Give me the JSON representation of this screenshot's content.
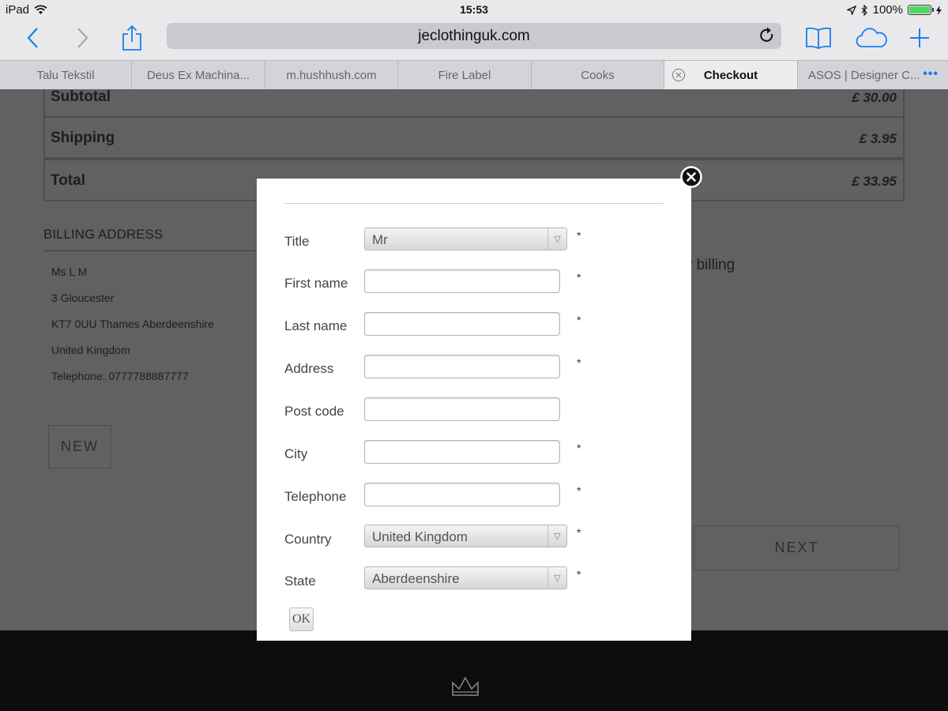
{
  "status_bar": {
    "device": "iPad",
    "time": "15:53",
    "battery": "100%"
  },
  "toolbar": {
    "url": "jeclothinguk.com"
  },
  "tabs": [
    {
      "label": "Talu Tekstil",
      "active": false
    },
    {
      "label": "Deus Ex Machina...",
      "active": false
    },
    {
      "label": "m.hushhush.com",
      "active": false
    },
    {
      "label": "Fire Label",
      "active": false
    },
    {
      "label": "Cooks",
      "active": false
    },
    {
      "label": "Checkout",
      "active": true
    },
    {
      "label": "ASOS | Designer C...",
      "active": false
    }
  ],
  "page": {
    "summary": [
      {
        "label": "Subtotal",
        "value": "£ 30.00"
      },
      {
        "label": "Shipping",
        "value": "£ 3.95"
      },
      {
        "label": "Total",
        "value": "£ 33.95"
      }
    ],
    "billing_heading": "BILLING ADDRESS",
    "address_lines": [
      "Ms L M",
      "3 Gloucester",
      "KT7 0UU Thames Aberdeenshire",
      "United Kingdom",
      "Telephone: 0777788887777"
    ],
    "new_button": "NEW",
    "side_text": "r billing",
    "next_button": "NEXT"
  },
  "modal": {
    "fields": [
      {
        "label": "Title",
        "type": "select",
        "value": "Mr",
        "required": "*"
      },
      {
        "label": "First name",
        "type": "input",
        "value": "",
        "required": "*"
      },
      {
        "label": "Last name",
        "type": "input",
        "value": "",
        "required": "*"
      },
      {
        "label": "Address",
        "type": "input",
        "value": "",
        "required": "*"
      },
      {
        "label": "Post code",
        "type": "input",
        "value": "",
        "required": ""
      },
      {
        "label": "City",
        "type": "input",
        "value": "",
        "required": "*"
      },
      {
        "label": "Telephone",
        "type": "input",
        "value": "",
        "required": "*"
      },
      {
        "label": "Country",
        "type": "select",
        "value": "United Kingdom",
        "required": "*"
      },
      {
        "label": "State",
        "type": "select",
        "value": "Aberdeenshire",
        "required": "*"
      }
    ],
    "ok_button": "OK"
  },
  "colors": {
    "ios_blue": "#1a7cf2",
    "overlay": "#616062",
    "battery_green": "#4cd964"
  }
}
